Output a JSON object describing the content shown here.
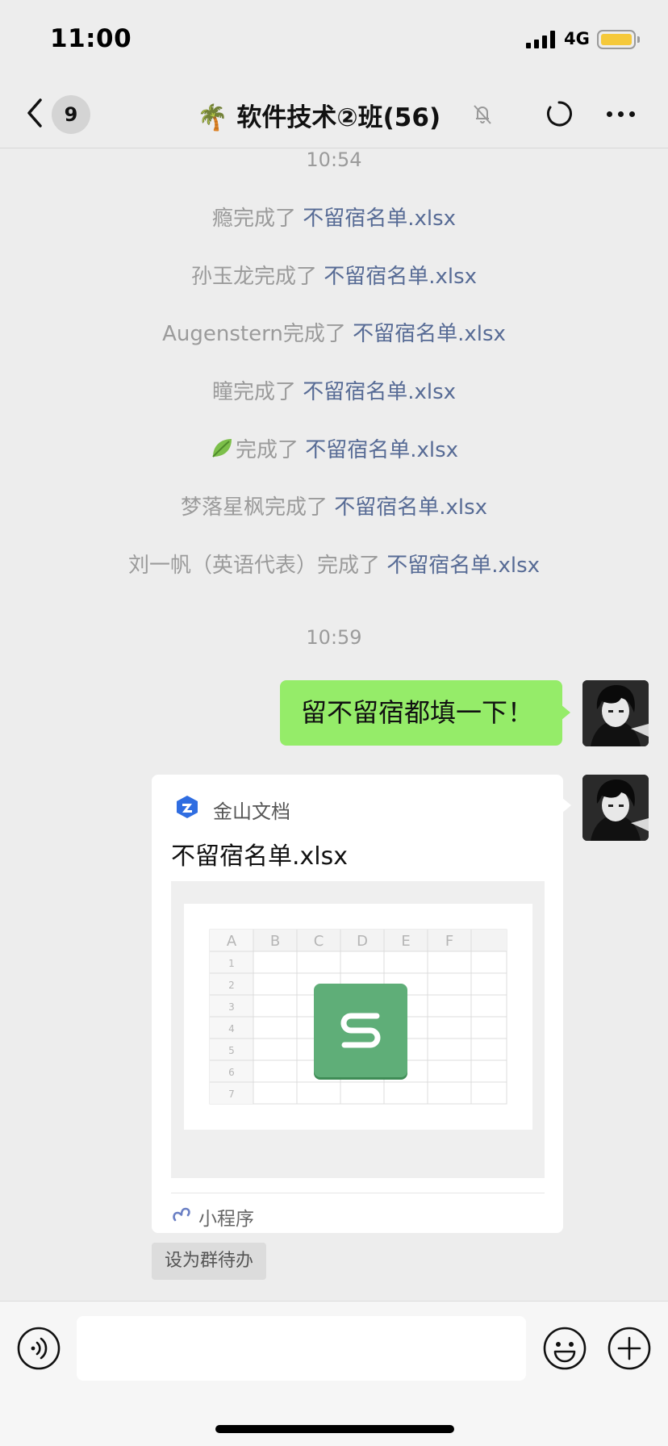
{
  "status_bar": {
    "time": "11:00",
    "network": "4G"
  },
  "header": {
    "unread_count": "9",
    "title": "🌴 软件技术②班(56)"
  },
  "chat": {
    "time_1": "10:54",
    "system_messages": [
      {
        "name": "瘾",
        "action": "完成了 ",
        "file": "不留宿名单.xlsx"
      },
      {
        "name": "孙玉龙",
        "action": "完成了 ",
        "file": "不留宿名单.xlsx"
      },
      {
        "name": "Augenstern",
        "action": "完成了 ",
        "file": "不留宿名单.xlsx"
      },
      {
        "name": "瞳",
        "action": "完成了 ",
        "file": "不留宿名单.xlsx"
      },
      {
        "name": "",
        "action": "完成了 ",
        "file": "不留宿名单.xlsx"
      },
      {
        "name": "梦落星枫",
        "action": "完成了 ",
        "file": "不留宿名单.xlsx"
      },
      {
        "name": "刘一帆（英语代表）",
        "action": "完成了 ",
        "file": "不留宿名单.xlsx"
      }
    ],
    "time_2": "10:59",
    "my_message": "留不留宿都填一下！",
    "card": {
      "app_name": "金山文档",
      "doc_title": "不留宿名单.xlsx",
      "columns": [
        "A",
        "B",
        "C",
        "D",
        "E",
        "F"
      ],
      "rows": [
        "1",
        "2",
        "3",
        "4",
        "5",
        "6",
        "7"
      ],
      "mini_program_label": "小程序"
    },
    "set_todo_label": "设为群待办"
  },
  "input": {
    "placeholder": ""
  },
  "colors": {
    "bubble_green": "#95ec69",
    "link_blue": "#576b95",
    "sheet_green": "#5fae78",
    "battery_yellow": "#f5c93b"
  }
}
